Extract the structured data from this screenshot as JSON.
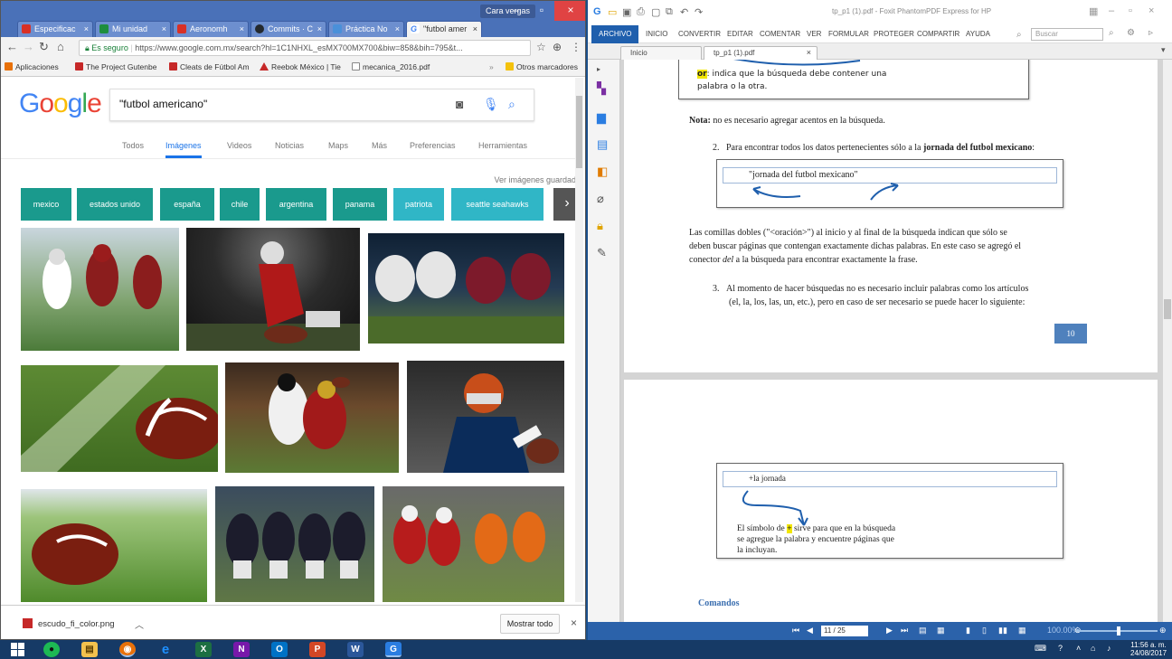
{
  "chrome": {
    "profile_label": "Cara vergas",
    "tabs": [
      {
        "label": "Especificac",
        "color": "#d93025"
      },
      {
        "label": "Mi unidad",
        "color": "#1e8e3e"
      },
      {
        "label": "Aeronomh",
        "color": "#d93025"
      },
      {
        "label": "Commits · C",
        "color": "#24292e"
      },
      {
        "label": "Práctica No",
        "color": "#4a90d9"
      },
      {
        "label": "\"futbol amer",
        "color": "#4285f4"
      }
    ],
    "url": {
      "secure_label": "Es seguro",
      "address": "https://www.google.com.mx/search?hl=1C1NHXL_esMX700MX700&biw=858&bih=795&t..."
    },
    "bookmarks": [
      {
        "label": "Aplicaciones",
        "color": "#e8710a"
      },
      {
        "label": "The Project Gutenbe",
        "color": "#c62828"
      },
      {
        "label": "Cleats de Fútbol Am",
        "color": "#c62828"
      },
      {
        "label": "Reebok México | Tie",
        "color": "#c62828"
      },
      {
        "label": "mecanica_2016.pdf",
        "color": "#888888"
      },
      {
        "label": "Otros marcadores",
        "color": "#f4c20d"
      }
    ],
    "google": {
      "logo_letters": [
        "G",
        "o",
        "o",
        "g",
        "l",
        "e"
      ],
      "query": "\"futbol americano\"",
      "nav_tabs": [
        "Todos",
        "Imágenes",
        "Videos",
        "Noticias",
        "Maps",
        "Más",
        "Preferencias",
        "Herramientas"
      ],
      "active_tab": "Imágenes",
      "save_link": "Ver imágenes guardad",
      "chips": [
        "mexico",
        "estados unido",
        "españa",
        "chile",
        "argentina",
        "panama",
        "patriota",
        "seattle seahawks"
      ]
    },
    "download": {
      "filename": "escudo_fi_color.png",
      "show_all": "Mostrar todo"
    }
  },
  "foxit": {
    "title": "tp_p1 (1).pdf - Foxit PhantomPDF Express for HP",
    "menu": [
      "ARCHIVO",
      "INICIO",
      "CONVERTIR",
      "EDITAR",
      "COMENTAR",
      "VER",
      "FORMULAR",
      "PROTEGER",
      "COMPARTIR",
      "AYUDA"
    ],
    "search_placeholder": "Buscar",
    "tabs": [
      "Inicio",
      "tp_p1 (1).pdf"
    ],
    "doc": {
      "hand_or_label": "or",
      "hand_or_text": ": indica que la búsqueda debe contener una",
      "hand_or_text2": "palabra o la otra.",
      "nota_bold": "Nota:",
      "nota_text": " no es necesario agregar acentos en la búsqueda.",
      "item2_num": "2.",
      "item2_text": "Para encontrar todos los datos pertenecientes sólo a la ",
      "item2_bold": "jornada del futbol mexicano",
      "item2_end": ":",
      "box1_query": "\"jornada del futbol mexicano\"",
      "para1_l1": "Las  comillas dobles  (\"<oración>\") al inicio y al final de la búsqueda indican que sólo se",
      "para1_l2": "deben buscar páginas que contengan exactamente dichas palabras. En este caso se agregó el",
      "para1_l3_a": "conector ",
      "para1_l3_i": "del",
      "para1_l3_b": " a la búsqueda para encontrar  exactamente la frase.",
      "item3_num": "3.",
      "item3_l1": "Al momento de hacer búsquedas no es necesario incluir palabras como los artículos",
      "item3_l2": "(el, la, los, las, un, etc.), pero en caso de ser necesario se puede hacer lo siguiente:",
      "page_number": "10",
      "box2_query": "+la jornada",
      "hand_plus_l1a": "El símbolo de ",
      "hand_plus_sym": "+",
      "hand_plus_l1b": " sirve para que en la búsqueda",
      "hand_plus_l2": "se agregue la palabra y encuentre páginas que",
      "hand_plus_l3": "la incluyan.",
      "comandos": "Comandos"
    },
    "status": {
      "page_box": "11 / 25",
      "zoom": "100.00%"
    }
  },
  "taskbar": {
    "time": "11:56 a. m.",
    "date": "24/08/2017",
    "apps": [
      {
        "name": "spotify",
        "glyph": "●",
        "color": "#1db954"
      },
      {
        "name": "file-explorer",
        "glyph": "▤",
        "color": "#f2c14e"
      },
      {
        "name": "chrome",
        "glyph": "◉",
        "color": "#e8710a"
      },
      {
        "name": "internet-explorer",
        "glyph": "e",
        "color": "#1e90ff"
      },
      {
        "name": "excel",
        "glyph": "X",
        "color": "#1d6f42"
      },
      {
        "name": "onenote",
        "glyph": "N",
        "color": "#7719aa"
      },
      {
        "name": "outlook",
        "glyph": "O",
        "color": "#0072c6"
      },
      {
        "name": "powerpoint",
        "glyph": "P",
        "color": "#d24726"
      },
      {
        "name": "word",
        "glyph": "W",
        "color": "#2b579a"
      },
      {
        "name": "foxit",
        "glyph": "G",
        "color": "#2a7de1"
      }
    ]
  }
}
